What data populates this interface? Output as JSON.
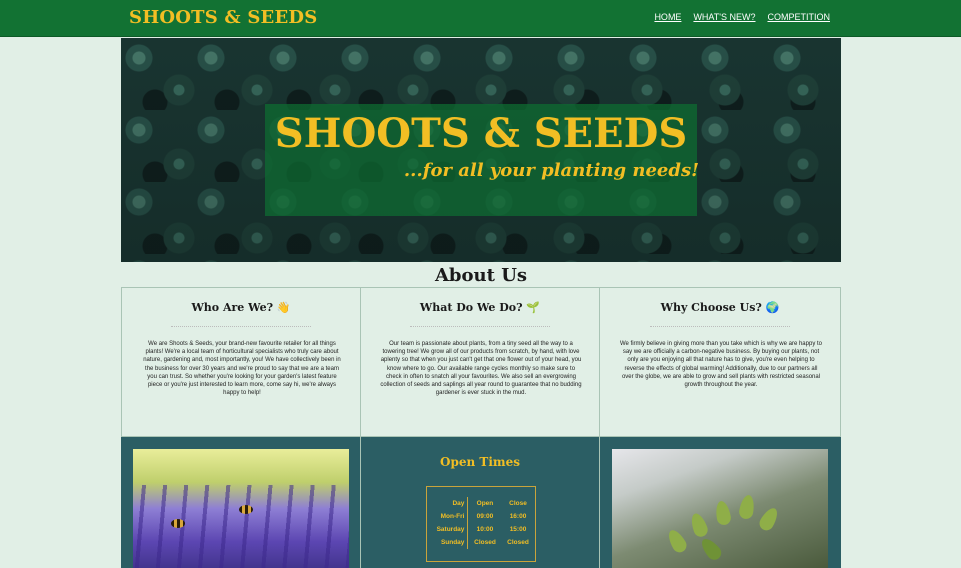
{
  "nav": {
    "brand": "SHOOTS & SEEDS",
    "links": [
      "HOME",
      "WHAT'S NEW?",
      "COMPETITION"
    ]
  },
  "hero": {
    "title": "SHOOTS & SEEDS",
    "subtitle": "...for all your planting needs!"
  },
  "about": {
    "heading": "About Us",
    "columns": [
      {
        "title": "Who Are We? 👋",
        "text": "We are Shoots & Seeds, your brand-new favourite retailer for all things plants! We're a local team of horticultural specialists who truly care about nature, gardening and, most importantly, you! We have collectively been in the business for over 30 years and we're proud to say that we are a team you can trust. So whether you're looking for your garden's latest feature piece or you're just interested to learn more, come say hi, we're always happy to help!"
      },
      {
        "title": "What Do We Do? 🌱",
        "text": "Our team is passionate about plants, from a tiny seed all the way to a towering tree! We grow all of our products from scratch, by hand, with love aplenty so that when you just can't get that one flower out of your head, you know where to go. Our available range cycles monthly so make sure to check in often to snatch all your favourites. We also sell an evergrowing collection of seeds and saplings all year round to guarantee that no budding gardener is ever stuck in the mud."
      },
      {
        "title": "Why Choose Us? 🌍",
        "text": "We firmly believe in giving more than you take which is why we are happy to say we are officially a carbon-negative business. By buying our plants, not only are you enjoying all that nature has to give, you're even helping to reverse the effects of global warming! Additionally, due to our partners all over the globe, we are able to grow and sell plants with restricted seasonal growth throughout the year."
      }
    ]
  },
  "open_times": {
    "title": "Open Times",
    "headers": [
      "Day",
      "Open",
      "Close"
    ],
    "rows": [
      [
        "Mon-Fri",
        "09:00",
        "16:00"
      ],
      [
        "Saturday",
        "10:00",
        "15:00"
      ],
      [
        "Sunday",
        "Closed",
        "Closed"
      ]
    ]
  },
  "colors": {
    "nav_bg": "#127233",
    "accent_gold": "#f2be24",
    "page_bg": "#e1efe6",
    "band_bg": "#2b5e64"
  }
}
